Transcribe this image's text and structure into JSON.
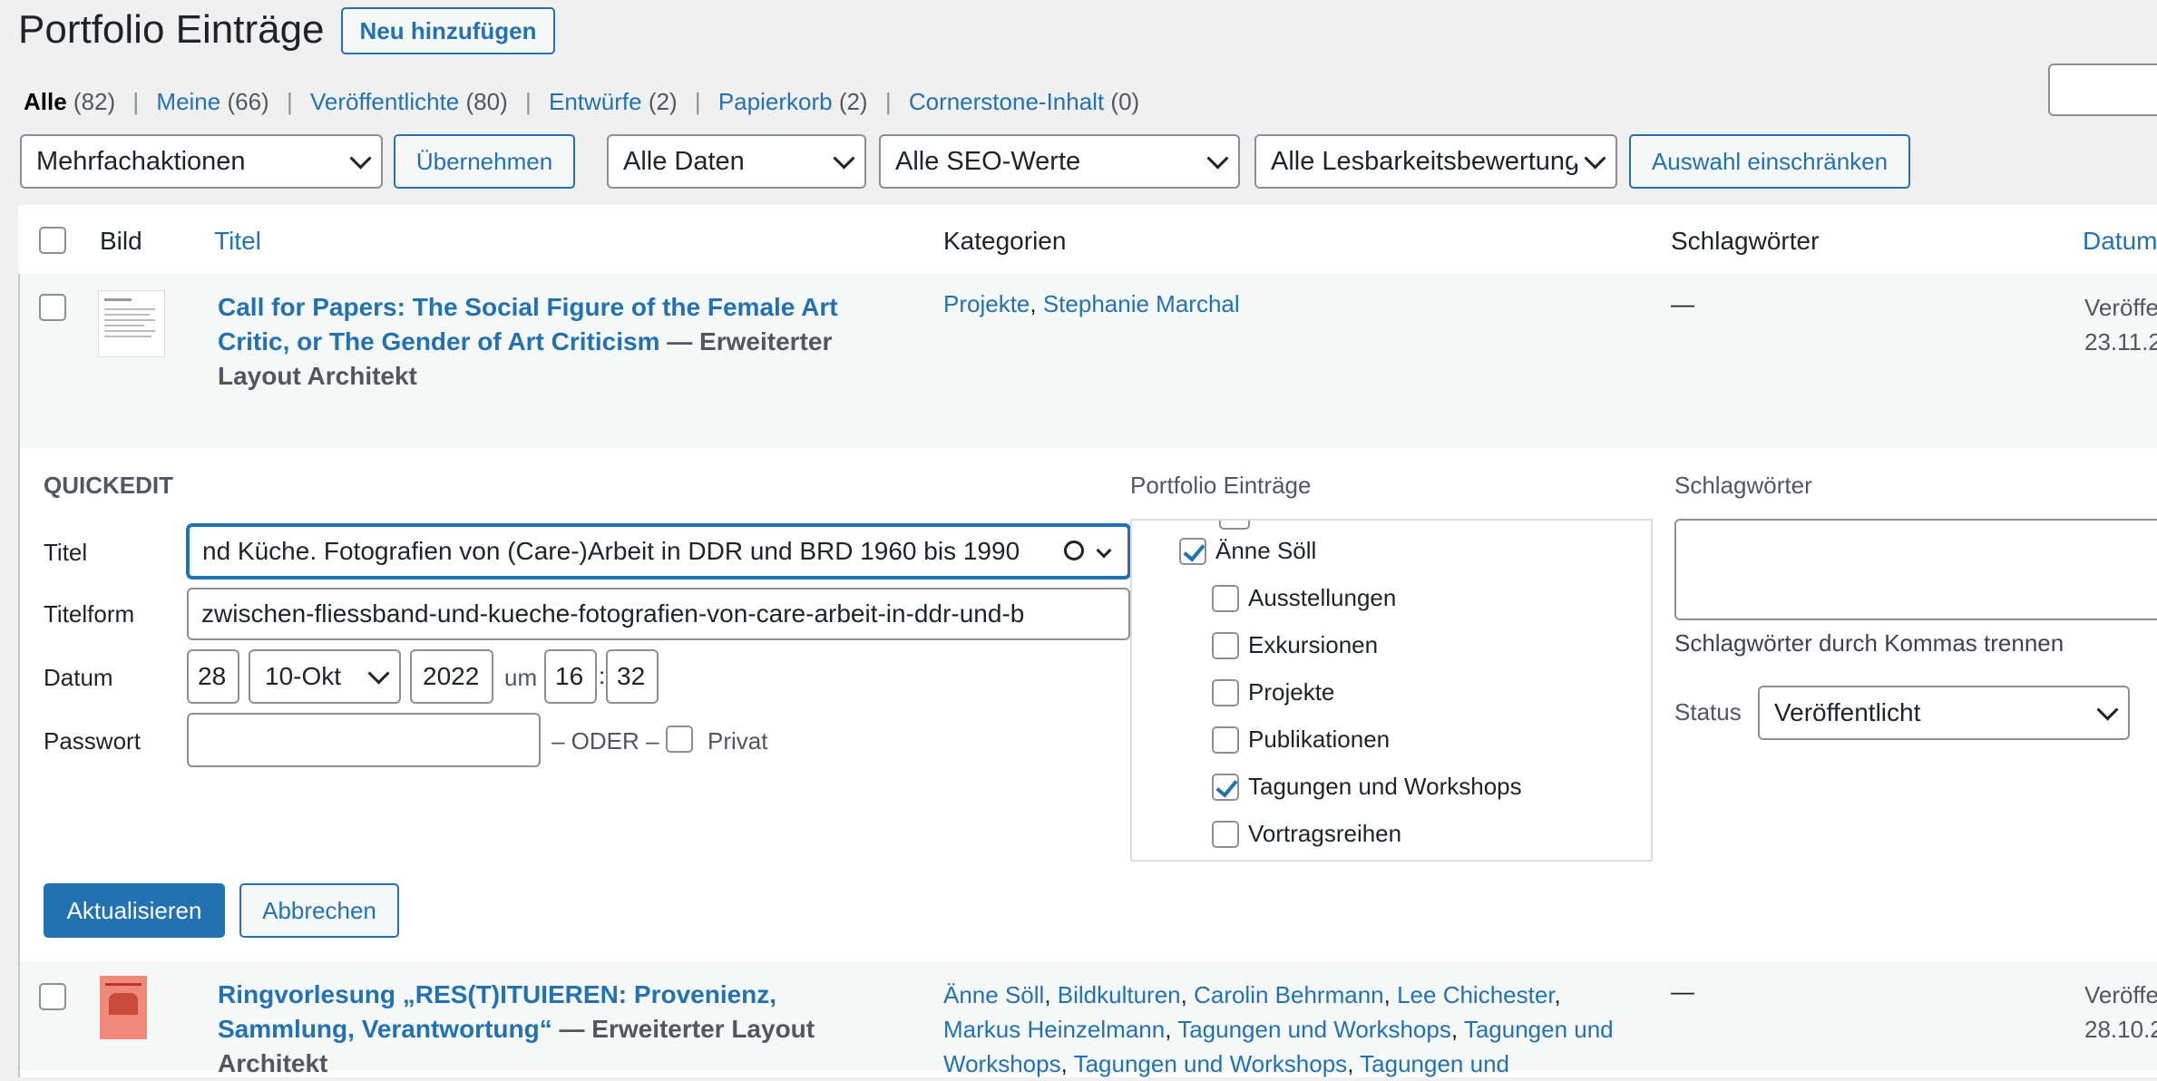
{
  "header": {
    "title": "Portfolio Einträge",
    "add_new": "Neu hinzufügen"
  },
  "filters": [
    {
      "label": "Alle",
      "count": "(82)"
    },
    {
      "label": "Meine",
      "count": "(66)"
    },
    {
      "label": "Veröffentlichte",
      "count": "(80)"
    },
    {
      "label": "Entwürfe",
      "count": "(2)"
    },
    {
      "label": "Papierkorb",
      "count": "(2)"
    },
    {
      "label": "Cornerstone-Inhalt",
      "count": "(0)"
    }
  ],
  "toolbar": {
    "bulk_actions": "Mehrfachaktionen",
    "apply": "Übernehmen",
    "dates": "Alle Daten",
    "seo": "Alle SEO-Werte",
    "readability": "Alle Lesbarkeitsbewertungen",
    "filter": "Auswahl einschränken"
  },
  "columns": {
    "image": "Bild",
    "title": "Titel",
    "categories": "Kategorien",
    "tags": "Schlagwörter",
    "date": "Datum"
  },
  "rows": [
    {
      "title": "Call for Papers: The Social Figure of the Female Art Critic, or The Gender of Art Criticism",
      "state": "— Erweiterter Layout Architekt",
      "categories": [
        "Projekte",
        "Stephanie Marchal"
      ],
      "tags": "—",
      "date_status": "Veröffe",
      "date": "23.11.2"
    },
    {
      "title": "Ringvorlesung „RES(T)ITUIEREN: Provenienz, Sammlung, Verantwortung“",
      "state": "— Erweiterter Layout Architekt",
      "categories": [
        "Änne Söll",
        "Bildkulturen",
        "Carolin Behrmann",
        "Lee Chichester",
        "Markus Heinzelmann",
        "Tagungen und Workshops",
        "Tagungen und Workshops",
        "Tagungen und Workshops",
        "Tagungen und"
      ],
      "tags": "—",
      "date_status": "Veröffe",
      "date": "28.10.2"
    }
  ],
  "quickedit": {
    "heading": "QUICKEDIT",
    "title_label": "Titel",
    "title_value": "nd Küche. Fotografien von (Care-)Arbeit in DDR und BRD 1960 bis 1990",
    "slug_label": "Titelform",
    "slug_value": "zwischen-fliessband-und-kueche-fotografien-von-care-arbeit-in-ddr-und-b",
    "date_label": "Datum",
    "day": "28",
    "month": "10-Okt",
    "year": "2022",
    "at": "um",
    "hour": "16",
    "colon": ":",
    "minute": "32",
    "password_label": "Passwort",
    "or": "– ODER –",
    "private": "Privat",
    "categories_label": "Portfolio Einträge",
    "categories": [
      {
        "label": "Änne Söll",
        "checked": true,
        "level": 0
      },
      {
        "label": "Ausstellungen",
        "checked": false,
        "level": 1
      },
      {
        "label": "Exkursionen",
        "checked": false,
        "level": 1
      },
      {
        "label": "Projekte",
        "checked": false,
        "level": 1
      },
      {
        "label": "Publikationen",
        "checked": false,
        "level": 1
      },
      {
        "label": "Tagungen und Workshops",
        "checked": true,
        "level": 1
      },
      {
        "label": "Vortragsreihen",
        "checked": false,
        "level": 1
      }
    ],
    "tags_label": "Schlagwörter",
    "tags_hint": "Schlagwörter durch Kommas trennen",
    "status_label": "Status",
    "status_value": "Veröffentlicht",
    "update": "Aktualisieren",
    "cancel": "Abbrechen"
  },
  "colors": {
    "accent": "#2271b1",
    "background": "#f0f0f1",
    "border": "#c3c4c7"
  }
}
